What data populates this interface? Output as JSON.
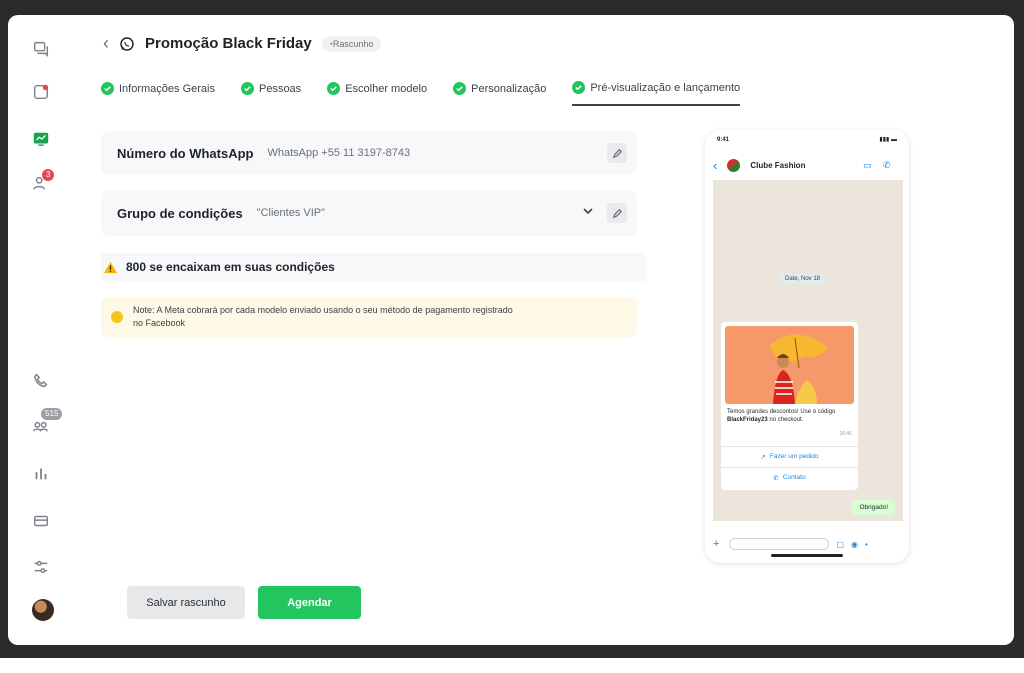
{
  "header": {
    "title": "Promoção Black Friday",
    "status_badge": "Rascunho",
    "back_icon": "chevron-left-icon",
    "channel_icon": "whatsapp-icon"
  },
  "sidebar": {
    "items": [
      {
        "icon": "inbox-icon"
      },
      {
        "icon": "notification-icon"
      },
      {
        "icon": "campaigns-icon",
        "active": true
      },
      {
        "icon": "contacts-icon",
        "badge": "3"
      },
      {
        "icon": "phone-icon"
      },
      {
        "icon": "team-icon",
        "badge": "515"
      },
      {
        "icon": "reports-icon"
      },
      {
        "icon": "billing-icon"
      },
      {
        "icon": "settings-sliders-icon"
      }
    ]
  },
  "steps": [
    {
      "label": "Informações Gerais",
      "done": true
    },
    {
      "label": "Pessoas",
      "done": true
    },
    {
      "label": "Escolher modelo",
      "done": true
    },
    {
      "label": "Personalização",
      "done": true
    },
    {
      "label": "Pré-visualização e lançamento",
      "done": true,
      "active": true
    }
  ],
  "form": {
    "whatsapp_label": "Número do WhatsApp",
    "whatsapp_value": "WhatsApp +55 11 3197-8743",
    "conditions_label": "Grupo de condições",
    "conditions_value": "\"Clientes VIP\"",
    "match_warning": "800 se encaixam em suas condições",
    "note": "Note: A Meta cobrará por cada modelo enviado usando o seu método de pagamento registrado no Facebook"
  },
  "buttons": {
    "save_draft": "Salvar rascunho",
    "schedule": "Agendar"
  },
  "preview": {
    "time": "9:41",
    "contact_name": "Clube Fashion",
    "date_chip": "Date, Nov 18",
    "message_before": "Temos grandes descontos! Use o código ",
    "message_code": "BlackFriday23",
    "message_after": " no checkout.",
    "message_time": "16:46",
    "quick_reply_1": "Fazer um pedido",
    "quick_reply_2": "Contato",
    "sent_reply": "Obrigado!"
  },
  "colors": {
    "accent_green": "#22c55e",
    "link_blue": "#1e88e5",
    "note_bg": "#fdf9e6",
    "media_bg": "#f5996b"
  }
}
